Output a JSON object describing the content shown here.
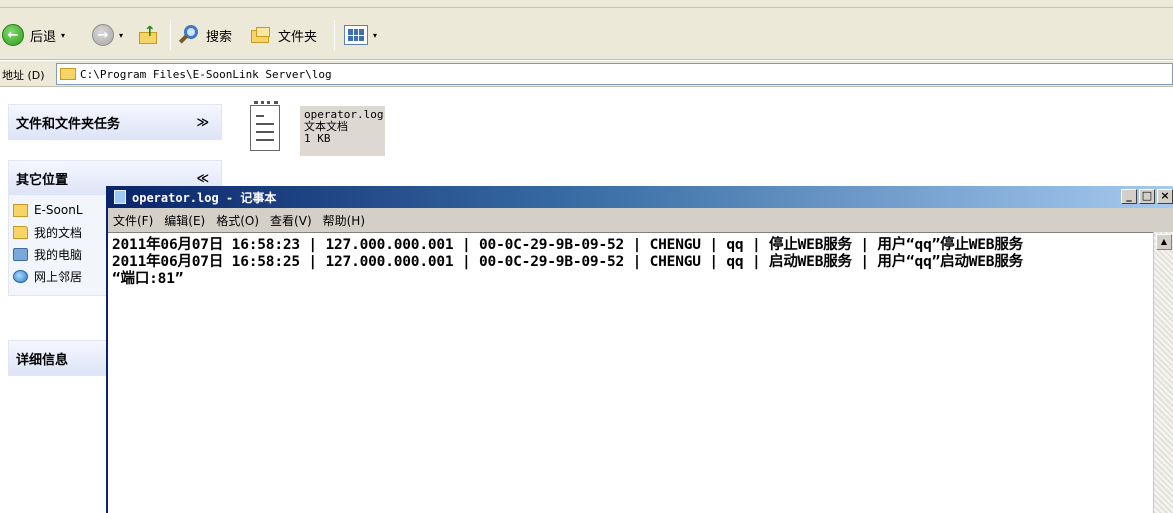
{
  "toolbar": {
    "back_label": "后退",
    "back_arrow": "←",
    "forward_arrow": "→",
    "dropdown_arrow": "▾",
    "up_arrow": "↑",
    "search_label": "搜索",
    "folders_label": "文件夹"
  },
  "address": {
    "label": "地址 (D)",
    "path": "C:\\Program Files\\E-SoonLink Server\\log"
  },
  "taskpane": {
    "file_tasks_title": "文件和文件夹任务",
    "file_tasks_chevron": "≫",
    "other_places_title": "其它位置",
    "other_places_chevron": "≪",
    "other_places": [
      "E-SoonL",
      "我的文档",
      "我的电脑",
      "网上邻居"
    ],
    "details_title": "详细信息"
  },
  "file": {
    "name": "operator.log",
    "type": "文本文档",
    "size": "1 KB"
  },
  "notepad": {
    "title": "operator.log - 记事本",
    "menu": [
      "文件(F)",
      "编辑(E)",
      "格式(O)",
      "查看(V)",
      "帮助(H)"
    ],
    "controls": [
      "_",
      "□",
      "×"
    ],
    "scroll_up": "▲",
    "lines": [
      "2011年06月07日 16:58:23 | 127.000.000.001 | 00-0C-29-9B-09-52 | CHENGU | qq | 停止WEB服务 | 用户“qq”停止WEB服务",
      "2011年06月07日 16:58:25 | 127.000.000.001 | 00-0C-29-9B-09-52 | CHENGU | qq | 启动WEB服务 | 用户“qq”启动WEB服务",
      "“端口:81”"
    ]
  }
}
